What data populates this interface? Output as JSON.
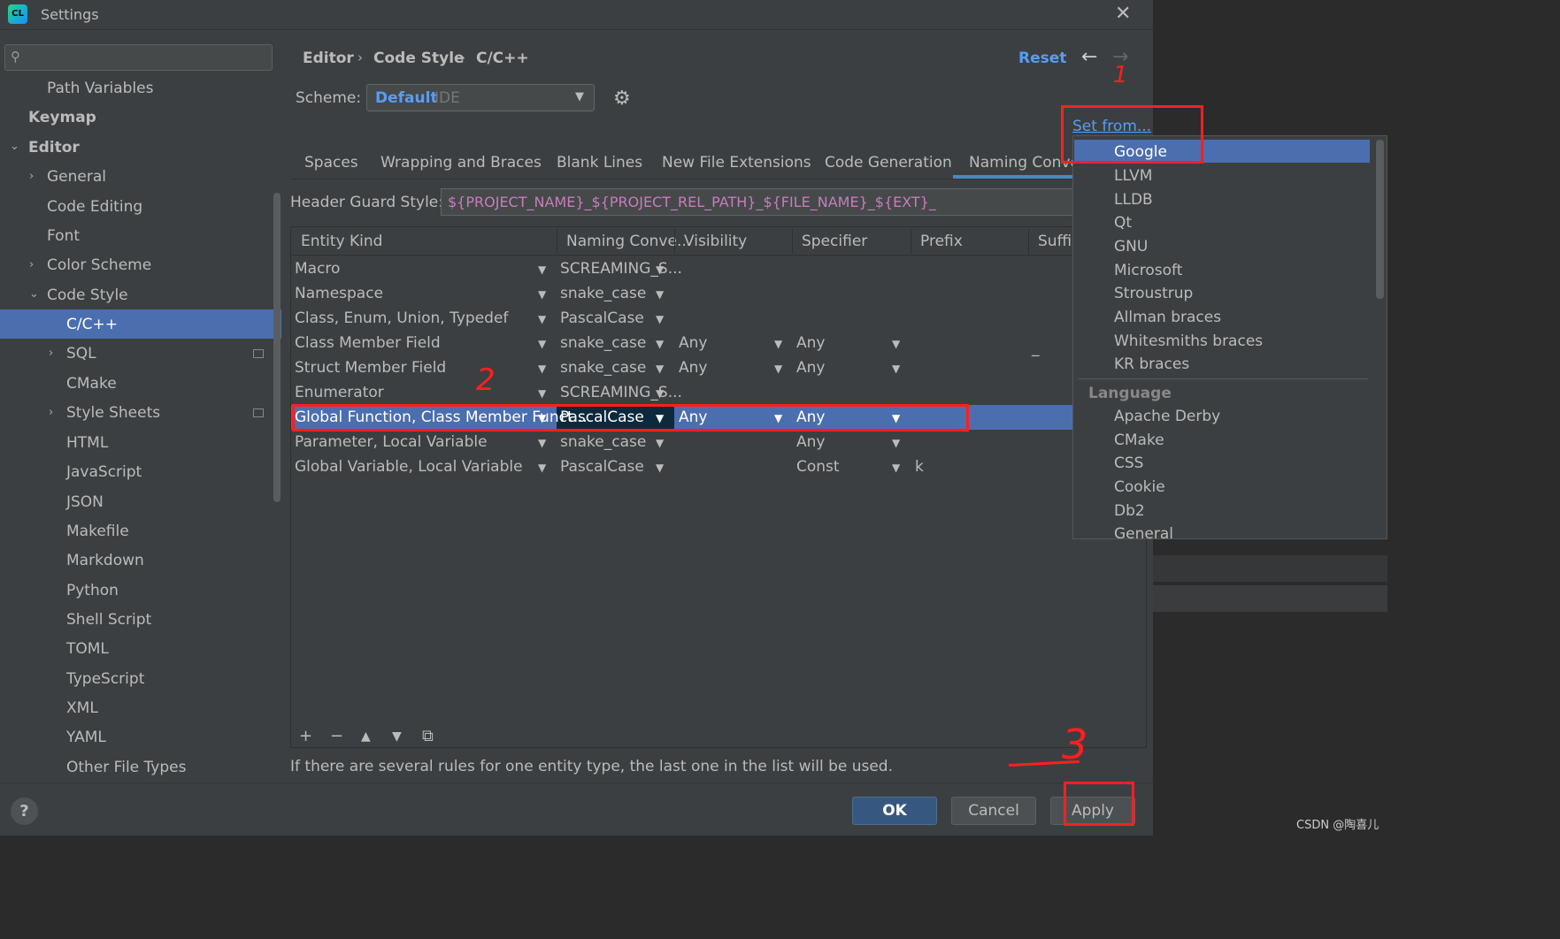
{
  "window": {
    "title": "Settings",
    "icon_text": "CL"
  },
  "sidebar": {
    "search_placeholder": "",
    "items": [
      {
        "label": "Path Variables"
      },
      {
        "label": "Keymap"
      },
      {
        "label": "Editor"
      },
      {
        "label": "General"
      },
      {
        "label": "Code Editing"
      },
      {
        "label": "Font"
      },
      {
        "label": "Color Scheme"
      },
      {
        "label": "Code Style"
      },
      {
        "label": "C/C++"
      },
      {
        "label": "SQL"
      },
      {
        "label": "CMake"
      },
      {
        "label": "Style Sheets"
      },
      {
        "label": "HTML"
      },
      {
        "label": "JavaScript"
      },
      {
        "label": "JSON"
      },
      {
        "label": "Makefile"
      },
      {
        "label": "Markdown"
      },
      {
        "label": "Python"
      },
      {
        "label": "Shell Script"
      },
      {
        "label": "TOML"
      },
      {
        "label": "TypeScript"
      },
      {
        "label": "XML"
      },
      {
        "label": "YAML"
      },
      {
        "label": "Other File Types"
      }
    ]
  },
  "breadcrumb": {
    "items": [
      "Editor",
      "Code Style",
      "C/C++"
    ],
    "separator": "›"
  },
  "header": {
    "reset": "Reset",
    "back": "←",
    "forward": "→"
  },
  "scheme": {
    "label": "Scheme:",
    "value": "Default",
    "suffix": "IDE"
  },
  "set_from": "Set from...",
  "tabs": [
    "Spaces",
    "Wrapping and Braces",
    "Blank Lines",
    "New File Extensions",
    "Code Generation",
    "Naming Conve"
  ],
  "header_guard": {
    "label": "Header Guard Style:",
    "value": "${PROJECT_NAME}_${PROJECT_REL_PATH}_${FILE_NAME}_${EXT}_"
  },
  "table": {
    "columns": [
      "Entity Kind",
      "Naming Conve...",
      "Visibility",
      "Specifier",
      "Prefix",
      "Suffix"
    ],
    "rows": [
      {
        "kind": "Macro",
        "naming": "SCREAMING_S...",
        "visibility": "",
        "specifier": "",
        "prefix": "",
        "suffix": ""
      },
      {
        "kind": "Namespace",
        "naming": "snake_case",
        "visibility": "",
        "specifier": "",
        "prefix": "",
        "suffix": ""
      },
      {
        "kind": "Class, Enum, Union, Typedef",
        "naming": "PascalCase",
        "visibility": "",
        "specifier": "",
        "prefix": "",
        "suffix": ""
      },
      {
        "kind": "Class Member Field",
        "naming": "snake_case",
        "visibility": "Any",
        "specifier": "Any",
        "prefix": "",
        "suffix": "_"
      },
      {
        "kind": "Struct Member Field",
        "naming": "snake_case",
        "visibility": "Any",
        "specifier": "Any",
        "prefix": "",
        "suffix": ""
      },
      {
        "kind": "Enumerator",
        "naming": "SCREAMING_S...",
        "visibility": "",
        "specifier": "",
        "prefix": "",
        "suffix": ""
      },
      {
        "kind": "Global Function, Class Member Funct...",
        "naming": "PascalCase",
        "visibility": "Any",
        "specifier": "Any",
        "prefix": "",
        "suffix": ""
      },
      {
        "kind": "Parameter, Local Variable",
        "naming": "snake_case",
        "visibility": "",
        "specifier": "Any",
        "prefix": "",
        "suffix": ""
      },
      {
        "kind": "Global Variable, Local Variable",
        "naming": "PascalCase",
        "visibility": "",
        "specifier": "Const",
        "prefix": "k",
        "suffix": ""
      }
    ],
    "toolbar": {
      "add": "+",
      "remove": "−",
      "up": "▲",
      "down": "▼",
      "copy": "⧉"
    }
  },
  "hint": "If there are several rules for one entity type, the last one in the list will be used.",
  "buttons": {
    "help": "?",
    "ok": "OK",
    "cancel": "Cancel",
    "apply": "Apply"
  },
  "popup": {
    "presets": [
      "Google",
      "LLVM",
      "LLDB",
      "Qt",
      "GNU",
      "Microsoft",
      "Stroustrup",
      "Allman braces",
      "Whitesmiths braces",
      "KR braces"
    ],
    "language_header": "Language",
    "languages": [
      "Apache Derby",
      "CMake",
      "CSS",
      "Cookie",
      "Db2",
      "General"
    ]
  },
  "annotations": {
    "n1": "1",
    "n2": "2",
    "n3": "3"
  },
  "watermark": "CSDN @陶喜儿",
  "colors": {
    "accent": "#4b6eaf",
    "link": "#589df6",
    "annotation_red": "#ff1f1f",
    "macro_value": "#c77dbb"
  }
}
